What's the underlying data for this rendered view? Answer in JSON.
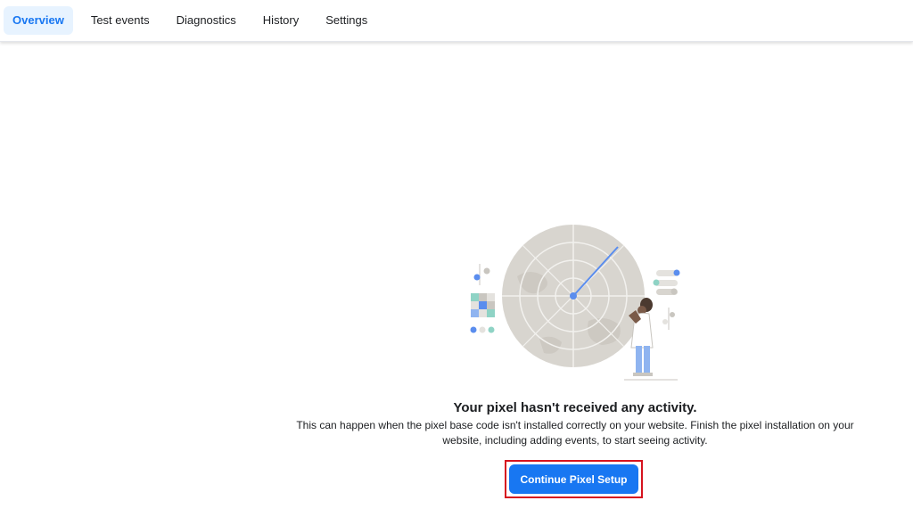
{
  "tabs": [
    {
      "label": "Overview",
      "active": true
    },
    {
      "label": "Test events",
      "active": false
    },
    {
      "label": "Diagnostics",
      "active": false
    },
    {
      "label": "History",
      "active": false
    },
    {
      "label": "Settings",
      "active": false
    }
  ],
  "empty_state": {
    "headline": "Your pixel hasn't received any activity.",
    "description": "This can happen when the pixel base code isn't installed correctly on your website. Finish the pixel installation on your website, including adding events, to start seeing activity.",
    "illustration": "radar-scientist-illustration"
  },
  "cta": {
    "label": "Continue Pixel Setup"
  },
  "colors": {
    "accent": "#1877f2",
    "active_tab_bg": "#e7f3ff",
    "highlight_border": "#d6131f"
  }
}
